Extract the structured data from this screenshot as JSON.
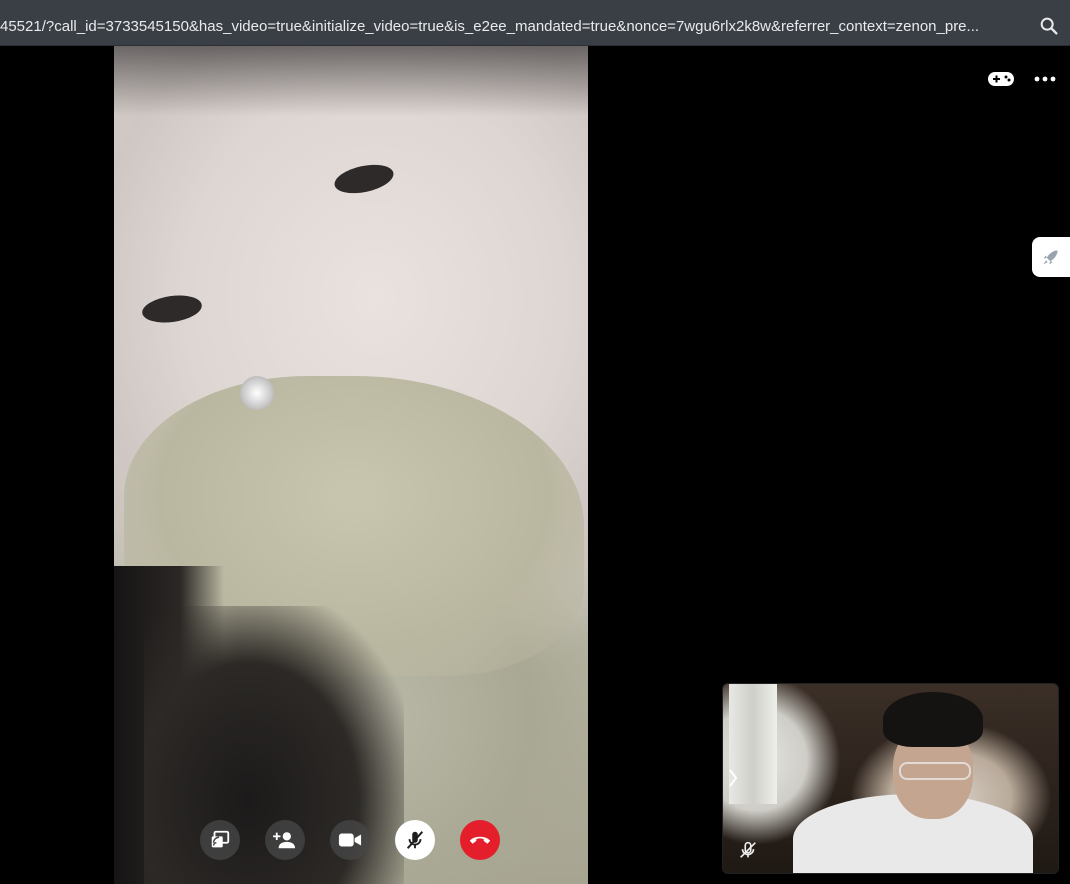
{
  "browser": {
    "url": "45521/?call_id=3733545150&has_video=true&initialize_video=true&is_e2ee_mandated=true&nonce=7wgu6rlx2k8w&referrer_context=zenon_pre..."
  },
  "icons": {
    "address_bar": "search-zoom-icon",
    "top_right": [
      "gamepad-icon",
      "more-options-icon"
    ],
    "side_tab": "rocket-icon",
    "call_controls": [
      "share-screen-icon",
      "add-person-icon",
      "video-camera-icon",
      "mute-microphone-icon",
      "end-call-icon"
    ],
    "self_view": [
      "chevron-right-icon",
      "microphone-muted-icon"
    ]
  },
  "colors": {
    "address_bar": "#3a3f45",
    "end_call": "#e41e2b",
    "control_dark": "#464646",
    "background": "#000000"
  },
  "state": {
    "microphone_muted": true,
    "video_on": true
  }
}
